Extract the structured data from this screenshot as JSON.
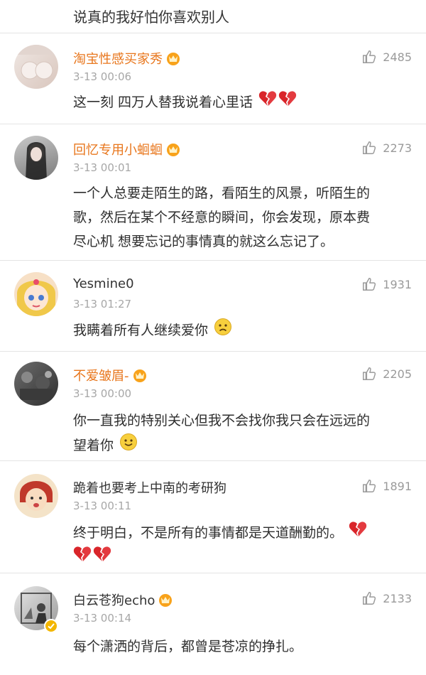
{
  "header_text": "说真的我好怕你喜欢别人",
  "comments": [
    {
      "name": "淘宝性感买家秀",
      "time": "3-13 00:06",
      "likes": "2485",
      "text": "这一刻 四万人替我说着心里话"
    },
    {
      "name": "回忆专用小蛔蛔",
      "time": "3-13 00:01",
      "likes": "2273",
      "text1": "一个人总要走陌生的路，看陌生的风景，听陌生的",
      "text2": "歌，然后在某个不经意的瞬间，你会发现，原本费",
      "text3": "尽心机 想要忘记的事情真的就这么忘记了。"
    },
    {
      "name": "Yesmine0",
      "time": "3-13 01:27",
      "likes": "1931",
      "text": "我瞒着所有人继续爱你"
    },
    {
      "name": "不爱皱眉-",
      "time": "3-13 00:00",
      "likes": "2205",
      "text1": "你一直我的特别关心但我不会找你我只会在远远的",
      "text2": "望着你"
    },
    {
      "name": "跪着也要考上中南的考研狗",
      "time": "3-13 00:11",
      "likes": "1891",
      "text": "终于明白，不是所有的事情都是天道酬勤的。"
    },
    {
      "name": "白云苍狗echo",
      "time": "3-13 00:14",
      "likes": "2133",
      "text": "每个潇洒的背后，都曾是苍凉的挣扎。"
    }
  ],
  "icons": {
    "like": "thumbs-up-icon",
    "vip": "crown-vip-icon",
    "broken_heart": "broken-heart-icon",
    "sad": "sad-face-icon",
    "smile": "smile-face-icon",
    "verified": "verified-badge-icon"
  },
  "colors": {
    "username_vip": "#e8761c",
    "meta": "#a7a7a7",
    "broken_heart": "#d9252a"
  }
}
